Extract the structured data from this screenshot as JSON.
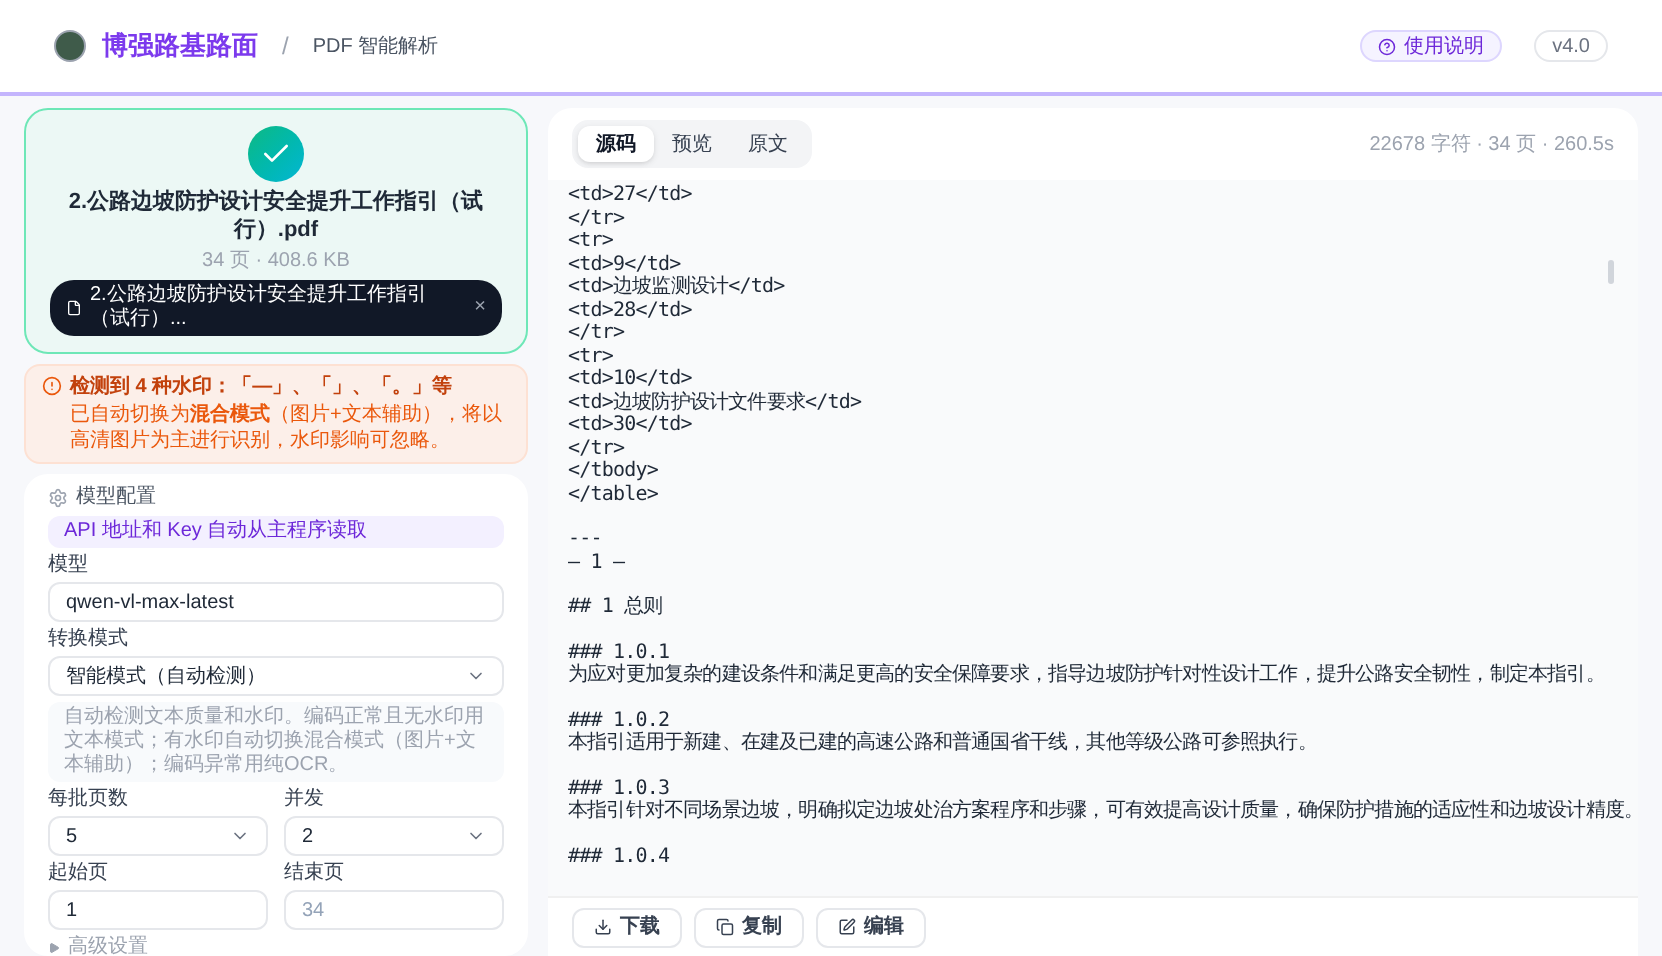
{
  "header": {
    "brand": "博强路基路面",
    "breadcrumb_separator": "/",
    "page_title": "PDF 智能解析",
    "help_button": "使用说明",
    "version": "v4.0"
  },
  "upload": {
    "file_name": "2.公路边坡防护设计安全提升工作指引（试行）.pdf",
    "file_meta": "34 页 · 408.6 KB",
    "chip_label": "2.公路边坡防护设计安全提升工作指引（试行）...",
    "chip_close": "×"
  },
  "warning": {
    "title": "检测到 4 种水印：「—」、「」、「。」等",
    "body": "已自动切换为**混合模式**（图片+文本辅助），将以高清图片为主进行识别，水印影响可忽略。"
  },
  "config": {
    "title": "模型配置",
    "info": "API 地址和 Key 自动从主程序读取",
    "fields": [
      {
        "kind": "input",
        "label": "模型",
        "value": "qwen-vl-max-latest"
      },
      {
        "kind": "select",
        "label": "转换模式",
        "value": "智能模式（自动检测）",
        "hint": "自动检测文本质量和水印。编码正常且无水印用文本模式；有水印自动切换混合模式（图片+文本辅助）；编码异常用纯OCR。"
      }
    ],
    "pairs": [
      [
        {
          "kind": "select",
          "label": "每批页数",
          "value": "5"
        },
        {
          "kind": "select",
          "label": "并发",
          "value": "2"
        }
      ],
      [
        {
          "kind": "input",
          "label": "起始页",
          "value": "1"
        },
        {
          "kind": "input",
          "label": "结束页",
          "placeholder": "34"
        }
      ]
    ],
    "advanced": {
      "label": "高级设置",
      "expanded": false
    }
  },
  "result": {
    "tabs": [
      {
        "label": "源码",
        "selected": true
      },
      {
        "label": "预览",
        "selected": false
      },
      {
        "label": "原文",
        "selected": false
      }
    ],
    "stats": "22678 字符 · 34 页 · 260.5s",
    "code_blocks": [
      [
        "<td>27</td>",
        "</tr>",
        "<tr>",
        "<td>9</td>",
        "<td>边坡监测设计</td>",
        "<td>28</td>",
        "</tr>",
        "<tr>",
        "<td>10</td>",
        "<td>边坡防护设计文件要求</td>",
        "<td>30</td>",
        "</tr>",
        "</tbody>",
        "</table>"
      ],
      [
        "---",
        "– 1 –"
      ],
      [
        "## 1 总则"
      ],
      [
        "### 1.0.1",
        "为应对更加复杂的建设条件和满足更高的安全保障要求，指导边坡防护针对性设计工作，提升公路安全韧性，制定本指引。"
      ],
      [
        "### 1.0.2",
        "本指引适用于新建、在建及已建的高速公路和普通国省干线，其他等级公路可参照执行。"
      ],
      [
        "### 1.0.3",
        "本指引针对不同场景边坡，明确拟定边坡处治方案程序和步骤，可有效提高设计质量，确保防护措施的适应性和边坡设计精度。"
      ],
      [
        "### 1.0.4"
      ]
    ],
    "actions": [
      {
        "kind": "download",
        "label": "下载"
      },
      {
        "kind": "copy",
        "label": "复制"
      },
      {
        "kind": "edit",
        "label": "编辑"
      }
    ]
  }
}
